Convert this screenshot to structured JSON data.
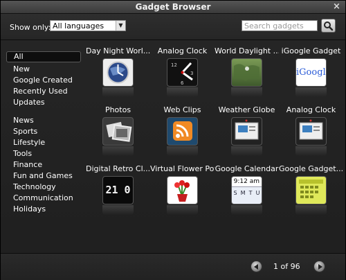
{
  "window": {
    "title": "Gadget Browser",
    "close_glyph": "×"
  },
  "toolbar": {
    "show_only_label": "Show only:",
    "language_value": "All languages",
    "search_placeholder": "Search gadgets"
  },
  "categories": {
    "primary": [
      "All",
      "New",
      "Google Created",
      "Recently Used",
      "Updates"
    ],
    "topics": [
      "News",
      "Sports",
      "Lifestyle",
      "Tools",
      "Finance",
      "Fun and Games",
      "Technology",
      "Communication",
      "Holidays"
    ]
  },
  "gadgets": [
    {
      "name": "Day Night Worl...",
      "icon": "day-night-world-icon"
    },
    {
      "name": "Analog Clock",
      "icon": "analog-clock-icon"
    },
    {
      "name": "World Daylight ...",
      "icon": "world-daylight-icon"
    },
    {
      "name": "iGoogle Gadget",
      "icon": "igoogle-icon",
      "thumb_text": "iGoogle"
    },
    {
      "name": "Photos",
      "icon": "photos-icon"
    },
    {
      "name": "Web Clips",
      "icon": "rss-icon"
    },
    {
      "name": "Weather Globe",
      "icon": "weather-globe-icon"
    },
    {
      "name": "Analog Clock",
      "icon": "analog-clock-icon"
    },
    {
      "name": "Digital Retro Cl...",
      "icon": "digital-retro-clock-icon",
      "thumb_text": "21 0"
    },
    {
      "name": "Virtual Flower Pot",
      "icon": "flower-pot-icon"
    },
    {
      "name": "Google Calendar",
      "icon": "calendar-icon",
      "thumb_text": "9:12 am",
      "thumb_days": [
        "S",
        "M",
        "T",
        "U"
      ]
    },
    {
      "name": "Google Gadget...",
      "icon": "gadget-calendar-icon"
    }
  ],
  "pager": {
    "text": "1 of 96"
  },
  "colors": {
    "background": "#262626",
    "selection": "#0e0e0e"
  }
}
